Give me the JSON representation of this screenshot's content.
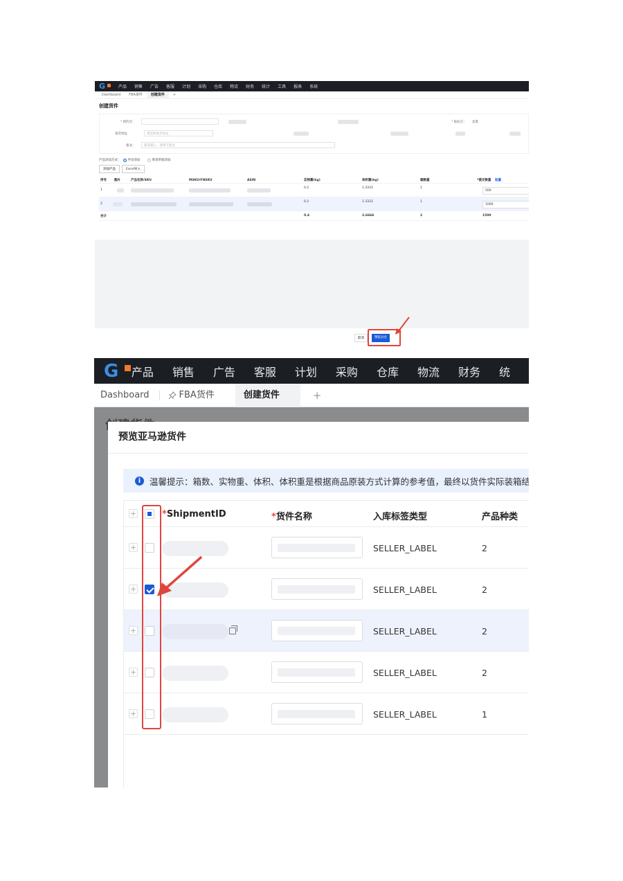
{
  "screenshot1": {
    "nav_items": [
      "产品",
      "销售",
      "广告",
      "客服",
      "计划",
      "采购",
      "仓库",
      "物流",
      "财务",
      "统计",
      "工具",
      "报表",
      "系统"
    ],
    "tabs": [
      "Dashboard",
      "FBA货件",
      "创建货件",
      "+"
    ],
    "page_title": "创建货件",
    "form": {
      "shipto_label": "* 目的仓：",
      "ship_from_label": "发货地址",
      "ship_from_placeholder": "请选择发货地址",
      "remark_label": "备注：",
      "remark_placeholder": "最多输入，请填写备注",
      "label_right": "* 贴标方：",
      "label_right_value": "卖家"
    },
    "add_method_label": "产品添加方式：",
    "add_methods": [
      "手动添加",
      "来源单据添加"
    ],
    "buttons": [
      "添加产品",
      "Excel导入"
    ],
    "table": {
      "headers": [
        "序号",
        "图片",
        "产品名称/SKU",
        "MSKU/FNSKU",
        "ASIN",
        "实物重(kg)",
        "体积重(kg)",
        "箱数量",
        "*提交数量",
        "批量"
      ],
      "rows": [
        {
          "index": "1",
          "weight": "0.2",
          "vol_weight": "1.3333",
          "boxes": "1",
          "qty": "500"
        },
        {
          "index": "2",
          "weight": "0.2",
          "vol_weight": "1.3333",
          "boxes": "1",
          "qty": "1000"
        }
      ],
      "footer": {
        "label": "合计",
        "weight": "0.4",
        "vol_weight": "2.6666",
        "boxes": "2",
        "qty": "1500"
      }
    },
    "cancel_label": "取消",
    "preview_label": "预览分仓"
  },
  "screenshot2": {
    "nav_items": [
      "产品",
      "销售",
      "广告",
      "客服",
      "计划",
      "采购",
      "仓库",
      "物流",
      "财务",
      "统"
    ],
    "tabs": {
      "dashboard": "Dashboard",
      "fba": "FBA货件",
      "create": "创建货件",
      "plus": "+"
    },
    "back_title": "创建货件",
    "modal_title": "预览亚马逊货件",
    "alert_icon": "i",
    "alert_text": "温馨提示：箱数、实物重、体积、体积重是根据商品原装方式计算的参考值，最终以货件实际装箱结果为准。",
    "headers": {
      "shipment_id": "ShipmentID",
      "shipment_name": "货件名称",
      "label_type": "入库标签类型",
      "product_types": "产品种类"
    },
    "rows": [
      {
        "label_type": "SELLER_LABEL",
        "product_types": "2",
        "checked": false
      },
      {
        "label_type": "SELLER_LABEL",
        "product_types": "2",
        "checked": true
      },
      {
        "label_type": "SELLER_LABEL",
        "product_types": "2",
        "checked": false
      },
      {
        "label_type": "SELLER_LABEL",
        "product_types": "2",
        "checked": false
      },
      {
        "label_type": "SELLER_LABEL",
        "product_types": "1",
        "checked": false
      }
    ],
    "colors": {
      "accent": "#1a5bd6",
      "nav_bg": "#1b1e23",
      "annotation": "#e0453c",
      "alert_bg": "#e8f1fc"
    }
  }
}
